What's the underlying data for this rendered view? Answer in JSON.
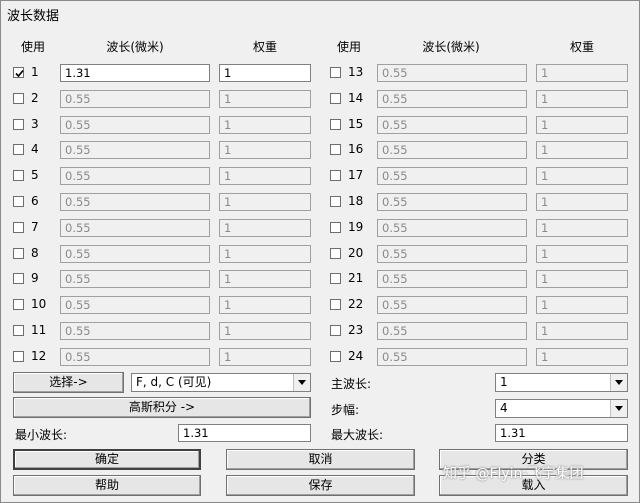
{
  "window": {
    "title": "波长数据"
  },
  "headers": {
    "use": "使用",
    "wavelength": "波长(微米)",
    "weight": "权重"
  },
  "rows": [
    {
      "num": "1",
      "checked": true,
      "wavelength": "1.31",
      "weight": "1"
    },
    {
      "num": "2",
      "checked": false,
      "wavelength": "0.55",
      "weight": "1"
    },
    {
      "num": "3",
      "checked": false,
      "wavelength": "0.55",
      "weight": "1"
    },
    {
      "num": "4",
      "checked": false,
      "wavelength": "0.55",
      "weight": "1"
    },
    {
      "num": "5",
      "checked": false,
      "wavelength": "0.55",
      "weight": "1"
    },
    {
      "num": "6",
      "checked": false,
      "wavelength": "0.55",
      "weight": "1"
    },
    {
      "num": "7",
      "checked": false,
      "wavelength": "0.55",
      "weight": "1"
    },
    {
      "num": "8",
      "checked": false,
      "wavelength": "0.55",
      "weight": "1"
    },
    {
      "num": "9",
      "checked": false,
      "wavelength": "0.55",
      "weight": "1"
    },
    {
      "num": "10",
      "checked": false,
      "wavelength": "0.55",
      "weight": "1"
    },
    {
      "num": "11",
      "checked": false,
      "wavelength": "0.55",
      "weight": "1"
    },
    {
      "num": "12",
      "checked": false,
      "wavelength": "0.55",
      "weight": "1"
    },
    {
      "num": "13",
      "checked": false,
      "wavelength": "0.55",
      "weight": "1"
    },
    {
      "num": "14",
      "checked": false,
      "wavelength": "0.55",
      "weight": "1"
    },
    {
      "num": "15",
      "checked": false,
      "wavelength": "0.55",
      "weight": "1"
    },
    {
      "num": "16",
      "checked": false,
      "wavelength": "0.55",
      "weight": "1"
    },
    {
      "num": "17",
      "checked": false,
      "wavelength": "0.55",
      "weight": "1"
    },
    {
      "num": "18",
      "checked": false,
      "wavelength": "0.55",
      "weight": "1"
    },
    {
      "num": "19",
      "checked": false,
      "wavelength": "0.55",
      "weight": "1"
    },
    {
      "num": "20",
      "checked": false,
      "wavelength": "0.55",
      "weight": "1"
    },
    {
      "num": "21",
      "checked": false,
      "wavelength": "0.55",
      "weight": "1"
    },
    {
      "num": "22",
      "checked": false,
      "wavelength": "0.55",
      "weight": "1"
    },
    {
      "num": "23",
      "checked": false,
      "wavelength": "0.55",
      "weight": "1"
    },
    {
      "num": "24",
      "checked": false,
      "wavelength": "0.55",
      "weight": "1"
    }
  ],
  "controls": {
    "select_button": "选择->",
    "preset_combo": "F, d, C (可见)",
    "gauss_button": "高斯积分 ->",
    "min_label": "最小波长:",
    "min_value": "1.31",
    "primary_label": "主波长:",
    "primary_value": "1",
    "step_label": "步幅:",
    "step_value": "4",
    "max_label": "最大波长:",
    "max_value": "1.31"
  },
  "buttons": {
    "ok": "确定",
    "cancel": "取消",
    "sort": "分类",
    "help": "帮助",
    "save": "保存",
    "load": "载入"
  },
  "watermark": "知乎 @Flyin-飞宇集团",
  "icons": {
    "checkmark": "checkmark-icon",
    "dropdown": "chevron-down-icon"
  }
}
